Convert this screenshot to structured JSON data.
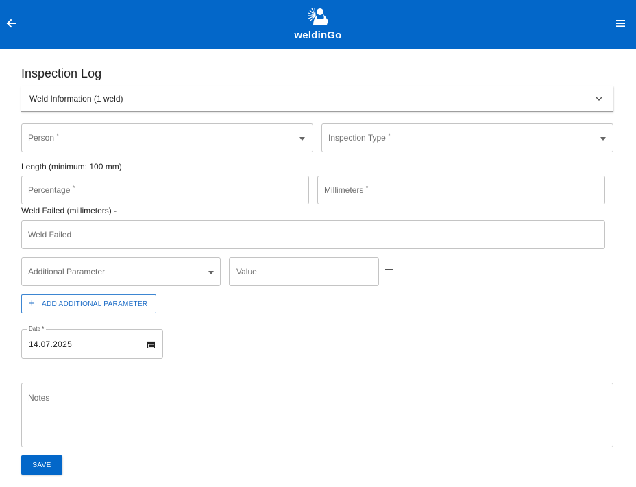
{
  "app": {
    "brand": "weldinGo",
    "back_icon": "arrow-left-icon",
    "menu_icon": "hamburger-menu-icon",
    "header_color": "#0367c9"
  },
  "page": {
    "title": "Inspection Log"
  },
  "accordion": {
    "label": "Weld Information (1 weld)",
    "icon": "chevron-down-icon"
  },
  "form": {
    "person": {
      "label": "Person",
      "required_mark": "*",
      "value": ""
    },
    "inspection_type": {
      "label": "Inspection Type",
      "required_mark": "*",
      "value": ""
    },
    "length_section_label": "Length (minimum: 100 mm)",
    "percentage": {
      "label": "Percentage",
      "required_mark": "*",
      "value": ""
    },
    "millimeters": {
      "label": "Millimeters",
      "required_mark": "*",
      "value": ""
    },
    "weld_failed_section_label": "Weld Failed (millimeters) -",
    "weld_failed": {
      "placeholder": "Weld Failed",
      "value": ""
    },
    "additional_parameter": {
      "label": "Additional Parameter",
      "value": ""
    },
    "parameter_value": {
      "placeholder": "Value",
      "value": ""
    },
    "remove_icon": "minus-icon",
    "add_parameter_label": "ADD ADDITIONAL PARAMETER",
    "date": {
      "label": "Date",
      "required_mark": "*",
      "value": "14.07.2025",
      "icon": "calendar-icon"
    },
    "notes": {
      "placeholder": "Notes",
      "value": ""
    },
    "save_label": "SAVE"
  }
}
